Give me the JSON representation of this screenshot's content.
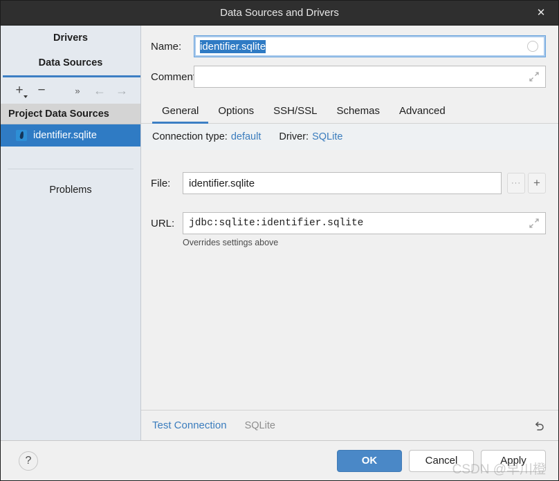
{
  "window": {
    "title": "Data Sources and Drivers",
    "close_icon": "close-icon",
    "close_glyph": "✕"
  },
  "sidebar": {
    "tabs": [
      {
        "label": "Drivers",
        "active": false
      },
      {
        "label": "Data Sources",
        "active": true
      }
    ],
    "toolbar": [
      {
        "name": "add-button",
        "glyph": "+"
      },
      {
        "name": "remove-button",
        "glyph": "−"
      },
      {
        "name": "more-button",
        "glyph": "»"
      },
      {
        "name": "back-button",
        "glyph": "←"
      },
      {
        "name": "forward-button",
        "glyph": "→"
      }
    ],
    "group_header": "Project Data Sources",
    "data_source": {
      "label": "identifier.sqlite",
      "icon": "sqlite-icon",
      "selected": true
    },
    "problems_label": "Problems"
  },
  "form": {
    "name_label": "Name:",
    "name_value": "identifier.sqlite",
    "name_placeholder": "",
    "comment_label": "Comment:",
    "comment_value": "",
    "comment_placeholder": ""
  },
  "tabs": [
    {
      "label": "General",
      "active": true
    },
    {
      "label": "Options",
      "active": false
    },
    {
      "label": "SSH/SSL",
      "active": false
    },
    {
      "label": "Schemas",
      "active": false
    },
    {
      "label": "Advanced",
      "active": false
    }
  ],
  "connection": {
    "type_label": "Connection type:",
    "type_value": "default",
    "driver_label": "Driver:",
    "driver_value": "SQLite"
  },
  "general": {
    "file_label": "File:",
    "file_value": "identifier.sqlite",
    "file_placeholder": "",
    "browse_glyph": "···",
    "add_glyph": "+",
    "url_label": "URL:",
    "url_value": "jdbc:sqlite:identifier.sqlite",
    "url_placeholder": "",
    "hint": "Overrides settings above"
  },
  "footer": {
    "test_connection": "Test Connection",
    "driver_name": "SQLite",
    "reset_icon": "undo-icon",
    "help_glyph": "?",
    "buttons": [
      {
        "label": "OK",
        "primary": true
      },
      {
        "label": "Cancel",
        "primary": false
      },
      {
        "label": "Apply",
        "primary": false
      }
    ]
  },
  "watermark": "CSDN @早川橙",
  "colors": {
    "accent": "#3c7fc4",
    "selection": "#2f7bc4",
    "link": "#3a7cbd",
    "titlebar": "#2f2f2f",
    "sidebar_bg": "#e4e9ef",
    "panel_bg": "#f0f0f0",
    "primary_button": "#4a88c7"
  }
}
